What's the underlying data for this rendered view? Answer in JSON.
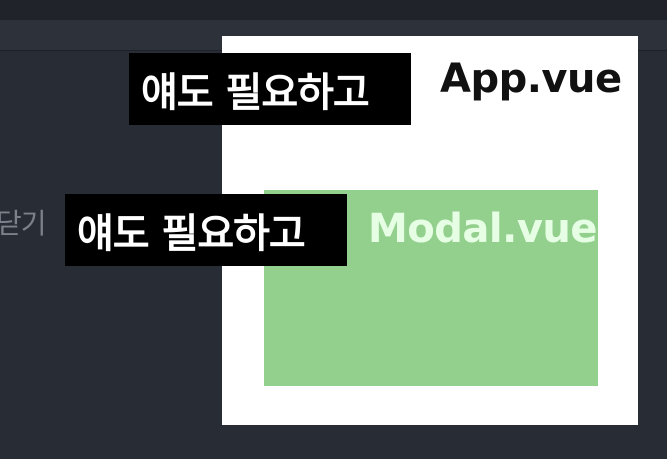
{
  "background_editor": {
    "ghost_text": "닫기"
  },
  "diagram": {
    "app_component": "App.vue",
    "modal_component": "Modal.vue"
  },
  "captions": {
    "line1": "얘도 필요하고",
    "line2": "얘도 필요하고"
  },
  "colors": {
    "editor_bg": "#282c34",
    "app_box": "#ffffff",
    "modal_box": "#93d08e",
    "modal_text": "#e6ffe4",
    "caption_bg": "#000000"
  }
}
